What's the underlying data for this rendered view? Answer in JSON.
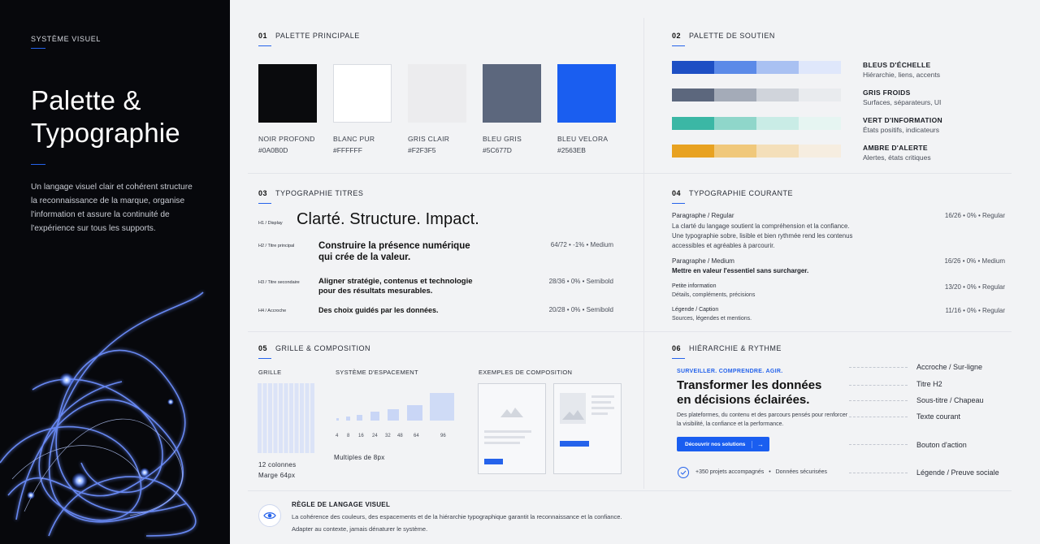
{
  "sidebar": {
    "eyebrow": "SYSTÈME VISUEL",
    "title_line1": "Palette &",
    "title_line2": "Typographie",
    "intro": "Un langage visuel clair et cohérent structure la reconnaissance de la marque, organise l'information et assure la continuité de l'expérience sur tous les supports."
  },
  "palette": {
    "num": "01",
    "title": "PALETTE PRINCIPALE",
    "swatches": [
      {
        "name": "NOIR PROFOND",
        "hex": "#0A0B0D",
        "color": "#0a0b0d"
      },
      {
        "name": "BLANC PUR",
        "hex": "#FFFFFF",
        "color": "#ffffff"
      },
      {
        "name": "GRIS CLAIR",
        "hex": "#F2F3F5",
        "color": "#ececee"
      },
      {
        "name": "BLEU GRIS",
        "hex": "#5C677D",
        "color": "#5c677d"
      },
      {
        "name": "BLEU VELORA",
        "hex": "#2563EB",
        "color": "#1a5ef0"
      }
    ]
  },
  "support": {
    "num": "02",
    "title": "PALETTE DE SOUTIEN",
    "rows": [
      {
        "label": "BLEUS D'ÉCHELLE",
        "desc": "Hiérarchie, liens, accents",
        "colors": [
          "#1d4fc4",
          "#5b8ae8",
          "#a9c1f2",
          "#dfe7fb"
        ]
      },
      {
        "label": "GRIS FROIDS",
        "desc": "Surfaces, séparateurs, UI",
        "colors": [
          "#5c677d",
          "#a4abb8",
          "#d0d4db",
          "#e9ebee"
        ]
      },
      {
        "label": "VERT D'INFORMATION",
        "desc": "États positifs, indicateurs",
        "colors": [
          "#3bb7a5",
          "#8fd6ca",
          "#c9ece6",
          "#e6f5f2"
        ]
      },
      {
        "label": "AMBRE D'ALERTE",
        "desc": "Alertes, états critiques",
        "colors": [
          "#e8a221",
          "#f0c87b",
          "#f4dfba",
          "#f6ede0"
        ]
      }
    ]
  },
  "headings": {
    "num": "03",
    "title": "TYPOGRAPHIE TITRES",
    "items": [
      {
        "tag": "H1 / Display",
        "text": "Clarté. Structure. Impact.",
        "meta": ""
      },
      {
        "tag": "H2 / Titre principal",
        "text_line1": "Construire la présence numérique",
        "text_line2": "qui crée de la valeur.",
        "meta": "64/72  •  -1%  •  Medium"
      },
      {
        "tag": "H3 / Titre secondaire",
        "text_line1": "Aligner stratégie, contenus et technologie",
        "text_line2": "pour des résultats mesurables.",
        "meta": "28/36  •  0%  •  Semibold"
      },
      {
        "tag": "H4 / Accroche",
        "text": "Des choix guidés par les données.",
        "meta": "20/28  •  0%  •  Semibold"
      }
    ]
  },
  "body_type": {
    "num": "04",
    "title": "TYPOGRAPHIE COURANTE",
    "items": [
      {
        "title": "Paragraphe / Regular",
        "lines": [
          "La clarté du langage soutient la compréhension et la confiance.",
          "Une typographie sobre, lisible et bien rythmée rend les contenus",
          "accessibles et agréables à parcourir."
        ],
        "meta": "16/26  •  0%  •  Regular"
      },
      {
        "title": "Paragraphe / Medium",
        "lines": [
          "Mettre en valeur l'essentiel sans surcharger."
        ],
        "meta": "16/26  •  0%  •  Medium"
      },
      {
        "title": "Petite information",
        "lines": [
          "Détails, compléments, précisions"
        ],
        "meta": "13/20  •  0%  •  Regular"
      },
      {
        "title": "Légende / Caption",
        "lines": [
          "Sources, légendes et mentions."
        ],
        "meta": "11/16  •  0%  •  Regular"
      }
    ]
  },
  "grid": {
    "num": "05",
    "title": "GRILLE & COMPOSITION",
    "grid_label": "GRILLE",
    "grid_caption1": "12 colonnes",
    "grid_caption2": "Marge 64px",
    "spacing_label": "SYSTÈME D'ESPACEMENT",
    "spacing_values": [
      "4",
      "8",
      "16",
      "24",
      "32",
      "48",
      "64",
      "96"
    ],
    "spacing_caption": "Multiples de 8px",
    "examples_label": "EXEMPLES DE COMPOSITION"
  },
  "hierarchy": {
    "num": "06",
    "title": "HIÉRARCHIE & RYTHME",
    "eyebrow": "SURVEILLER. COMPRENDRE. AGIR.",
    "headline_line1": "Transformer les données",
    "headline_line2": "en décisions éclairées.",
    "body": "Des plateformes, du contenu et des parcours pensés pour renforcer la visibilité, la confiance et la performance.",
    "cta": "Découvrir nos solutions",
    "cta_arrow": "→",
    "proof_1": "+350 projets accompagnés",
    "proof_2": "Données sécurisées",
    "labels": [
      "Accroche / Sur-ligne",
      "Titre H2",
      "Sous-titre / Chapeau",
      "Texte courant",
      "Bouton d'action",
      "Légende / Preuve sociale"
    ]
  },
  "rule": {
    "title": "RÈGLE DE LANGAGE VISUEL",
    "line1": "La cohérence des couleurs, des espacements et de la hiérarchie typographique garantit la reconnaissance et la confiance.",
    "line2": "Adapter au contexte, jamais dénaturer le système."
  }
}
